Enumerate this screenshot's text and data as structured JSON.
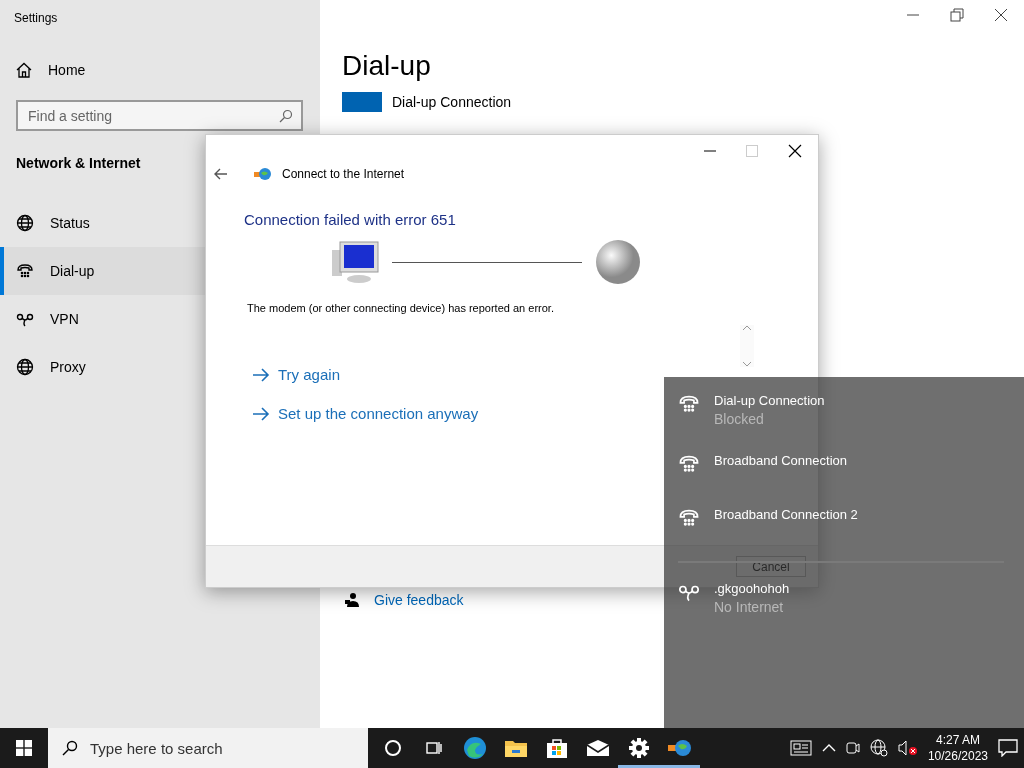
{
  "settings": {
    "title": "Settings",
    "home": "Home",
    "search": {
      "placeholder": "Find a setting"
    },
    "section": "Network & Internet",
    "items": [
      {
        "label": "Status",
        "kind": "status",
        "selected": false
      },
      {
        "label": "Dial-up",
        "kind": "dialup",
        "selected": true
      },
      {
        "label": "VPN",
        "kind": "vpn",
        "selected": false
      },
      {
        "label": "Proxy",
        "kind": "proxy",
        "selected": false
      }
    ],
    "heading": "Dial-up",
    "connection": "Dial-up Connection",
    "feedback": "Give feedback"
  },
  "dialog": {
    "title": "Connect to the Internet",
    "maximize_disabled": true,
    "heading": "Connection failed with error 651",
    "message": "The modem (or other connecting device) has reported an error.",
    "links": [
      "Try again",
      "Set up the connection anyway"
    ],
    "cancel": "Cancel"
  },
  "flyout": {
    "items": [
      {
        "name": "Dial-up Connection",
        "status": "Blocked",
        "kind": "dialup"
      },
      {
        "name": "Broadband Connection",
        "kind": "dialup"
      },
      {
        "name": "Broadband Connection 2",
        "kind": "dialup"
      },
      {
        "name": ".gkgoohohoh",
        "status": "No Internet",
        "kind": "vpn"
      }
    ]
  },
  "taskbar": {
    "search": {
      "placeholder": "Type here to search"
    },
    "apps": [
      {
        "kind": "cortana",
        "running": false
      },
      {
        "kind": "taskview",
        "running": false
      },
      {
        "kind": "edge",
        "running": false
      },
      {
        "kind": "explorer",
        "running": false
      },
      {
        "kind": "store",
        "running": false
      },
      {
        "kind": "mail",
        "running": false
      },
      {
        "kind": "settings",
        "running": true
      },
      {
        "kind": "connect",
        "running": true
      }
    ],
    "time": "4:27 AM",
    "date": "10/26/2023"
  }
}
